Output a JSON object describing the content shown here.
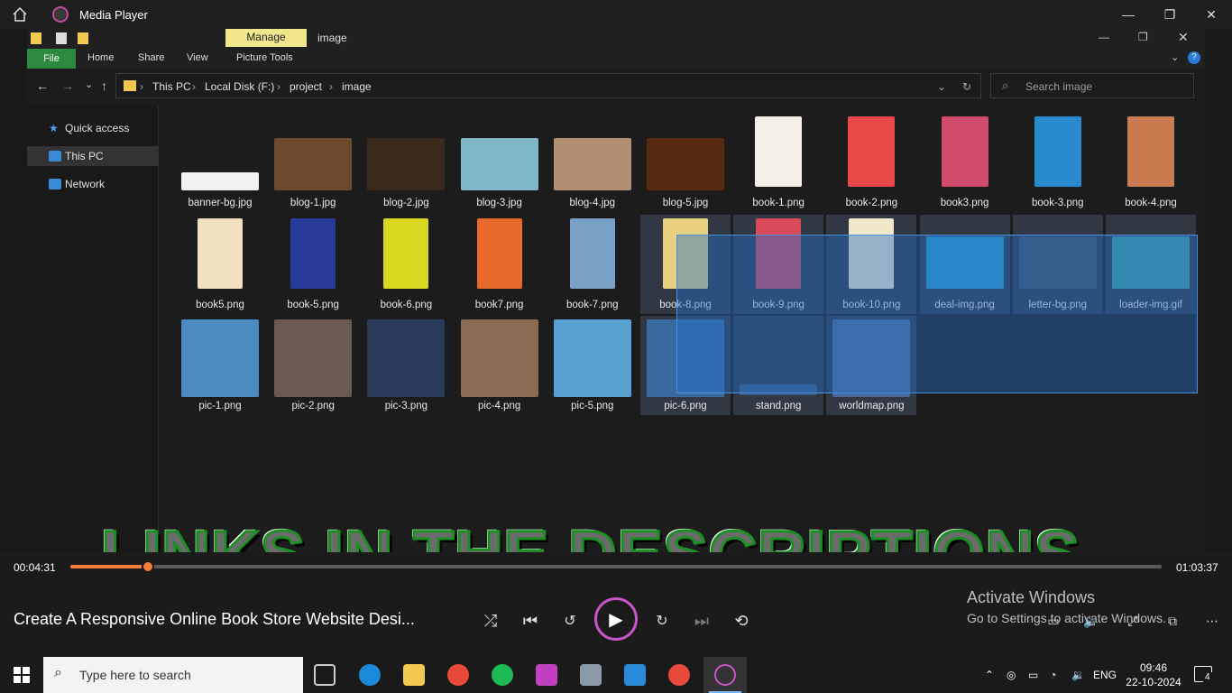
{
  "app": {
    "title": "Media Player",
    "window_controls": [
      "—",
      "❐",
      "✕"
    ]
  },
  "explorer": {
    "title": "image",
    "manage_tab": "Manage",
    "ribbon_tabs": [
      "File",
      "Home",
      "Share",
      "View",
      "Picture Tools"
    ],
    "breadcrumbs": [
      "This PC",
      "Local Disk (F:)",
      "project",
      "image"
    ],
    "search_placeholder": "Search image",
    "nav": [
      {
        "label": "Quick access",
        "icon": "star-icon"
      },
      {
        "label": "This PC",
        "icon": "computer-icon"
      },
      {
        "label": "Network",
        "icon": "network-icon"
      }
    ],
    "files": [
      "banner-bg.jpg",
      "blog-1.jpg",
      "blog-2.jpg",
      "blog-3.jpg",
      "blog-4.jpg",
      "blog-5.jpg",
      "book-1.png",
      "book-2.png",
      "book3.png",
      "book-3.png",
      "book-4.png",
      "book5.png",
      "book-5.png",
      "book-6.png",
      "book7.png",
      "book-7.png",
      "book-8.png",
      "book-9.png",
      "book-10.png",
      "deal-img.png",
      "letter-bg.png",
      "loader-img.gif",
      "pic-1.png",
      "pic-2.png",
      "pic-3.png",
      "pic-4.png",
      "pic-5.png",
      "pic-6.png",
      "stand.png",
      "worldmap.png"
    ],
    "file_colors": [
      "#f2f2f2",
      "#6b4a2e",
      "#3a2a1e",
      "#7fb6c8",
      "#b09070",
      "#5a2a10",
      "#f4f0e8",
      "#e84a4a",
      "#d04a6a",
      "#2a8ad0",
      "#c87a50",
      "#f0e0c0",
      "#2a3a9a",
      "#d8d820",
      "#e86a2a",
      "#7aa0c8",
      "#e8d080",
      "#d84a5a",
      "#f0e8c8",
      "#2a9ac8",
      "#405060",
      "#40a0a0",
      "#4a8ac0",
      "#6a5a50",
      "#2a3a5a",
      "#8a6a50",
      "#5aa0d0",
      "#3a6aa0",
      "#3a5a80",
      "#4a6a9a"
    ],
    "watermark": "LINKS IN THE DESCRIPTIONS"
  },
  "player": {
    "elapsed": "00:04:31",
    "duration": "01:03:37",
    "progress": 0.071,
    "media_title": "Create A Responsive Online Book Store Website Desi...",
    "activate_line1": "Activate Windows",
    "activate_line2": "Go to Settings to activate Windows."
  },
  "taskbar": {
    "search_placeholder": "Type here to search",
    "language": "ENG",
    "time": "09:46",
    "date": "22-10-2024",
    "notifications": "4"
  }
}
